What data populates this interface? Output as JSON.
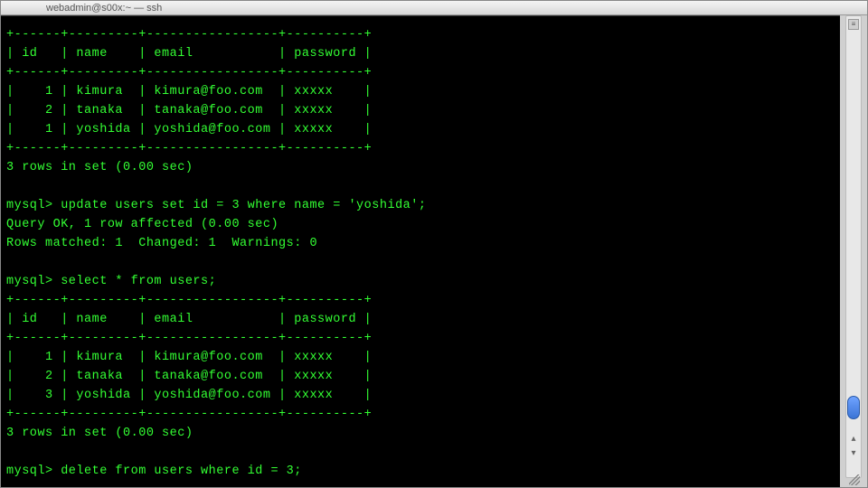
{
  "window": {
    "title": "webadmin@s00x:~ — ssh"
  },
  "terminal": {
    "lines": [
      "+------+---------+-----------------+----------+",
      "| id   | name    | email           | password |",
      "+------+---------+-----------------+----------+",
      "|    1 | kimura  | kimura@foo.com  | xxxxx    |",
      "|    2 | tanaka  | tanaka@foo.com  | xxxxx    |",
      "|    1 | yoshida | yoshida@foo.com | xxxxx    |",
      "+------+---------+-----------------+----------+",
      "3 rows in set (0.00 sec)",
      "",
      "mysql> update users set id = 3 where name = 'yoshida';",
      "Query OK, 1 row affected (0.00 sec)",
      "Rows matched: 1  Changed: 1  Warnings: 0",
      "",
      "mysql> select * from users;",
      "+------+---------+-----------------+----------+",
      "| id   | name    | email           | password |",
      "+------+---------+-----------------+----------+",
      "|    1 | kimura  | kimura@foo.com  | xxxxx    |",
      "|    2 | tanaka  | tanaka@foo.com  | xxxxx    |",
      "|    3 | yoshida | yoshida@foo.com | xxxxx    |",
      "+------+---------+-----------------+----------+",
      "3 rows in set (0.00 sec)",
      "",
      "mysql> delete from users where id = 3;"
    ]
  },
  "meta": {
    "db_tables": {
      "users_before": {
        "columns": [
          "id",
          "name",
          "email",
          "password"
        ],
        "rows": [
          [
            1,
            "kimura",
            "kimura@foo.com",
            "xxxxx"
          ],
          [
            2,
            "tanaka",
            "tanaka@foo.com",
            "xxxxx"
          ],
          [
            1,
            "yoshida",
            "yoshida@foo.com",
            "xxxxx"
          ]
        ]
      },
      "users_after": {
        "columns": [
          "id",
          "name",
          "email",
          "password"
        ],
        "rows": [
          [
            1,
            "kimura",
            "kimura@foo.com",
            "xxxxx"
          ],
          [
            2,
            "tanaka",
            "tanaka@foo.com",
            "xxxxx"
          ],
          [
            3,
            "yoshida",
            "yoshida@foo.com",
            "xxxxx"
          ]
        ]
      }
    },
    "statements": [
      "update users set id = 3 where name = 'yoshida';",
      "select * from users;",
      "delete from users where id = 3;"
    ],
    "prompt": "mysql>",
    "rows_in_set": "3 rows in set (0.00 sec)",
    "update_result": {
      "query_ok": "Query OK, 1 row affected (0.00 sec)",
      "matched": 1,
      "changed": 1,
      "warnings": 0
    }
  },
  "scrollbar": {
    "up_glyph": "▴",
    "down_glyph": "▾",
    "menu_glyph": "≡"
  }
}
